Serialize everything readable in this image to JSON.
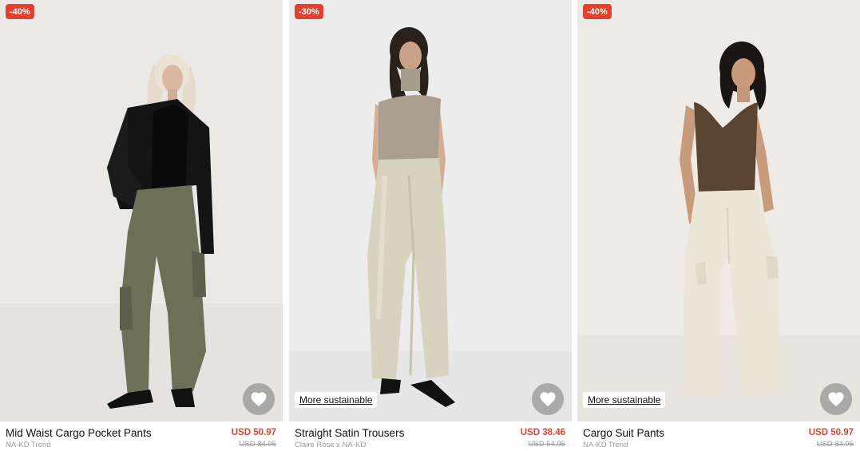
{
  "products": [
    {
      "discount": "-40%",
      "name": "Mid Waist Cargo Pocket Pants",
      "brand": "NA-KD Trend",
      "price": "USD 50.97",
      "old_price": "USD 84.95",
      "badge": "",
      "wishlist_icon": "heart-icon"
    },
    {
      "discount": "-30%",
      "name": "Straight Satin Trousers",
      "brand": "Claire Rose x NA-KD",
      "price": "USD 38.46",
      "old_price": "USD 54.95",
      "badge": "More sustainable",
      "wishlist_icon": "heart-icon"
    },
    {
      "discount": "-40%",
      "name": "Cargo Suit Pants",
      "brand": "NA-KD Trend",
      "price": "USD 50.97",
      "old_price": "USD 84.95",
      "badge": "More sustainable",
      "wishlist_icon": "heart-icon"
    }
  ],
  "colors": {
    "sale_red": "#e2412e",
    "muted_gray": "#9a9a9a",
    "photo_bg": "#ebe9e6"
  }
}
